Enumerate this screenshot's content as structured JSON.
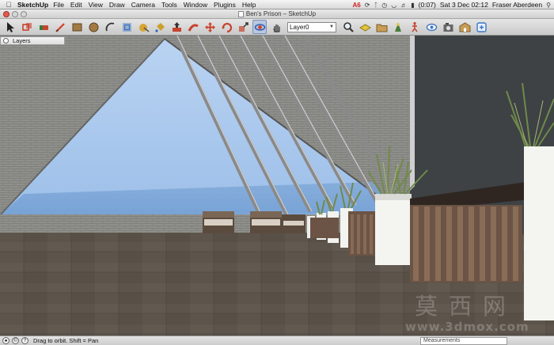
{
  "menubar": {
    "app_name": "SketchUp",
    "menus": [
      "File",
      "Edit",
      "View",
      "Draw",
      "Camera",
      "Tools",
      "Window",
      "Plugins",
      "Help"
    ],
    "status": {
      "adobe_badge": "6",
      "battery": "(0:07)",
      "datetime": "Sat 3 Dec  02:12",
      "user": "Fraser Aberdeen"
    }
  },
  "window": {
    "title": "Ben's Prison – SketchUp"
  },
  "toolbar": {
    "tools": [
      {
        "name": "select-tool-icon",
        "color": "#222222"
      },
      {
        "name": "make-component-icon",
        "color": "#c8432e"
      },
      {
        "name": "eraser-icon",
        "color": "#c8432e"
      },
      {
        "name": "pencil-line-icon",
        "color": "#d23b2b"
      },
      {
        "name": "rectangle-icon",
        "color": "#a47a44"
      },
      {
        "name": "circle-icon",
        "color": "#a47a44"
      },
      {
        "name": "arc-icon",
        "color": "#333333"
      },
      {
        "name": "offset-icon",
        "color": "#3e74c2"
      },
      {
        "name": "tape-measure-icon",
        "color": "#d8a430"
      },
      {
        "name": "paint-bucket-icon",
        "color": "#cc9f2f"
      },
      {
        "name": "push-pull-icon",
        "color": "#c8432e"
      },
      {
        "name": "follow-me-icon",
        "color": "#c8432e"
      },
      {
        "name": "move-icon",
        "color": "#c8432e"
      },
      {
        "name": "rotate-icon",
        "color": "#c8432e"
      },
      {
        "name": "scale-icon",
        "color": "#c8432e"
      },
      {
        "name": "orbit-icon",
        "color": "#3b5fb0"
      },
      {
        "name": "pan-icon",
        "color": "#444444"
      }
    ],
    "layer_select_value": "Layer0",
    "tools_right": [
      {
        "name": "zoom-icon",
        "color": "#333333"
      },
      {
        "name": "layer-icon",
        "color": "#e2c33b"
      },
      {
        "name": "folder-icon",
        "color": "#c79c55"
      },
      {
        "name": "position-camera-icon",
        "color": "#4a7d3a"
      },
      {
        "name": "walk-icon",
        "color": "#c8432e"
      },
      {
        "name": "look-around-icon",
        "color": "#3e74c2"
      },
      {
        "name": "photo-textures-icon",
        "color": "#444444"
      },
      {
        "name": "3d-warehouse-icon",
        "color": "#c79c55"
      },
      {
        "name": "extension-icon",
        "color": "#3e74c2"
      }
    ]
  },
  "layers_panel": {
    "title": "Layers"
  },
  "status_bar": {
    "hint": "Drag to orbit.  Shift = Pan",
    "measurements_label": "Measurements"
  },
  "watermark": {
    "cn": "莫西网",
    "url": "www.3dmox.com"
  },
  "colors": {
    "brick": "#8c8c88",
    "sky": "#a7c6ec",
    "floor": "#5e554b",
    "dark_wall": "#3d4144",
    "planter": "#f4f4f0",
    "timber": "#6b5445"
  }
}
